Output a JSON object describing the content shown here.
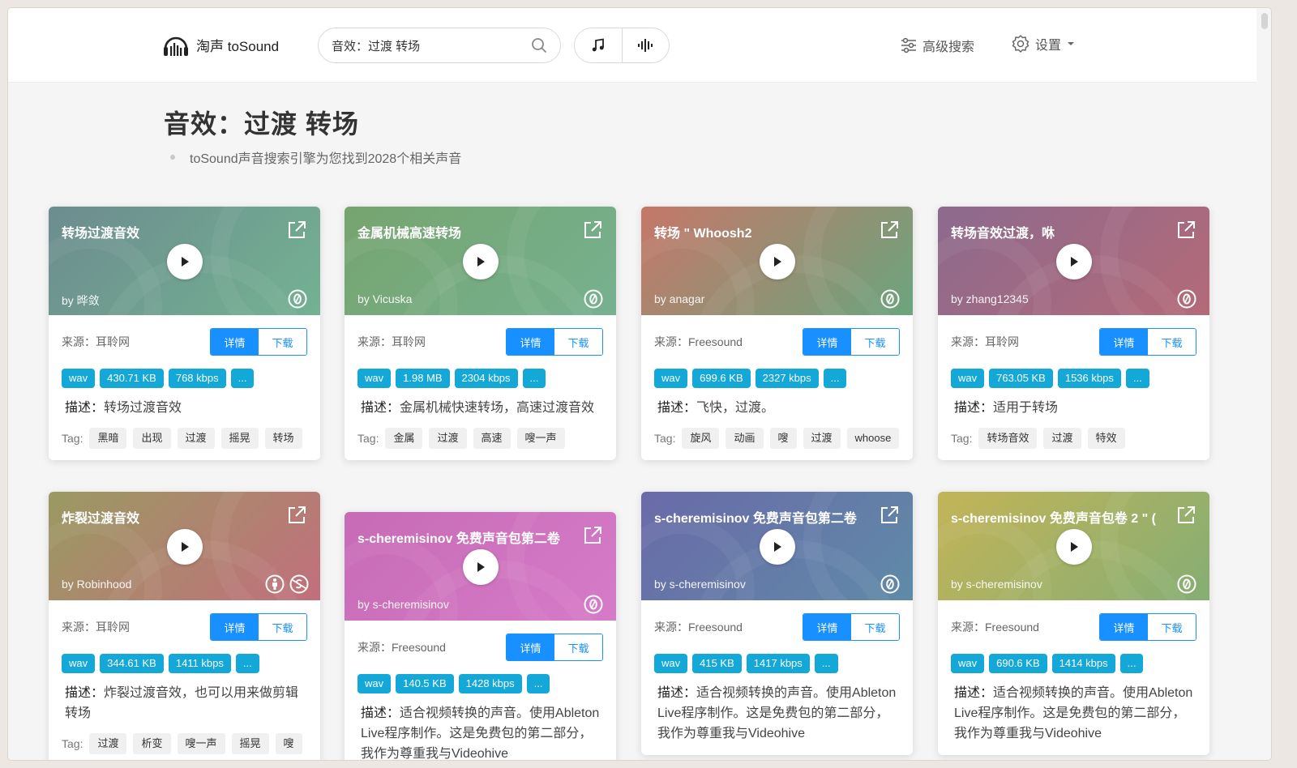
{
  "header": {
    "logo_text": "淘声 toSound",
    "search_value": "音效：过渡 转场",
    "advanced_label": "高级搜索",
    "settings_label": "设置"
  },
  "page": {
    "title": "音效：过渡 转场",
    "summary": "toSound声音搜索引擎为您找到2028个相关声音"
  },
  "labels": {
    "detail": "详情",
    "download": "下载",
    "desc_prefix": "描述：",
    "tag_prefix": "Tag:",
    "more": "..."
  },
  "cards": [
    {
      "title": "转场过渡音效",
      "author": "by 晔敛",
      "source": "来源：耳聆网",
      "format": "wav",
      "size": "430.71 KB",
      "bitrate": "768 kbps",
      "desc": "转场过渡音效",
      "tags": [
        "黑暗",
        "出现",
        "过渡",
        "摇晃",
        "转场"
      ],
      "color_a": "#6d8c8f",
      "color_b": "#73b292",
      "license": "cc0"
    },
    {
      "title": "金属机械高速转场",
      "author": "by Vicuska",
      "source": "来源：耳聆网",
      "format": "wav",
      "size": "1.98 MB",
      "bitrate": "2304 kbps",
      "desc": "金属机械快速转场，高速过渡音效",
      "tags": [
        "金属",
        "过渡",
        "高速",
        "嗖一声"
      ],
      "color_a": "#76a46f",
      "color_b": "#76b190",
      "license": "cc0"
    },
    {
      "title": "转场 \" Whoosh2",
      "author": "by anagar",
      "source": "来源：Freesound",
      "format": "wav",
      "size": "699.6 KB",
      "bitrate": "2327 kbps",
      "desc": "飞快，过渡。",
      "tags": [
        "旋风",
        "动画",
        "嗖",
        "过渡",
        "whoose"
      ],
      "color_a": "#c67769",
      "color_b": "#6aa57d",
      "license": "cc0"
    },
    {
      "title": "转场音效过渡，咻",
      "author": "by zhang12345",
      "source": "来源：耳聆网",
      "format": "wav",
      "size": "763.05 KB",
      "bitrate": "1536 kbps",
      "desc": "适用于转场",
      "tags": [
        "转场音效",
        "过渡",
        "特效"
      ],
      "color_a": "#8c6a8e",
      "color_b": "#b46a78",
      "license": "cc0"
    },
    {
      "title": "炸裂过渡音效",
      "author": "by Robinhood",
      "source": "来源：耳聆网",
      "format": "wav",
      "size": "344.61 KB",
      "bitrate": "1411 kbps",
      "desc": "炸裂过渡音效，也可以用来做剪辑转场",
      "tags": [
        "过渡",
        "析变",
        "嗖一声",
        "摇晃",
        "嗖"
      ],
      "color_a": "#9a9a62",
      "color_b": "#c26f7c",
      "license": "by-nc"
    },
    {
      "title": "s-cheremisinov 免费声音包第二卷",
      "author": "by s-cheremisinov",
      "source": "来源：Freesound",
      "format": "wav",
      "size": "140.5 KB",
      "bitrate": "1428 kbps",
      "desc": "适合视频转换的声音。使用Ableton Live程序制作。这是免费包的第二部分，我作为尊重我与Videohive",
      "tags": [],
      "color_a": "#c76bb6",
      "color_b": "#d67bc8",
      "license": "cc0"
    },
    {
      "title": "s-cheremisinov 免费声音包第二卷",
      "author": "by s-cheremisinov",
      "source": "来源：Freesound",
      "format": "wav",
      "size": "415 KB",
      "bitrate": "1417 kbps",
      "desc": "适合视频转换的声音。使用Ableton Live程序制作。这是免费包的第二部分，我作为尊重我与Videohive",
      "tags": [],
      "color_a": "#6a6aa8",
      "color_b": "#5f8aa8",
      "license": "cc0"
    },
    {
      "title": "s-cheremisinov 免费声音包卷 2 \" (",
      "author": "by s-cheremisinov",
      "source": "来源：Freesound",
      "format": "wav",
      "size": "690.6 KB",
      "bitrate": "1414 kbps",
      "desc": "适合视频转换的声音。使用Ableton Live程序制作。这是免费包的第二部分，我作为尊重我与Videohive",
      "tags": [],
      "color_a": "#c3b457",
      "color_b": "#85ae74",
      "license": "cc0"
    }
  ]
}
